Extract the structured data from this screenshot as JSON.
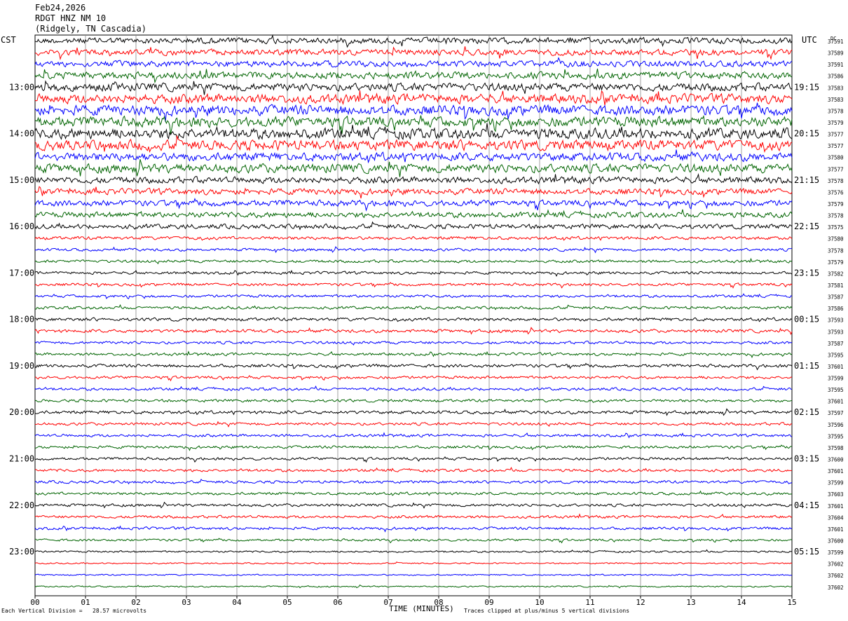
{
  "header": {
    "date": "Feb24,2026",
    "station": "RDGT HNZ NM 10",
    "location": "(Ridgely, TN Cascadia)"
  },
  "tz_left": "CST",
  "tz_right": "UTC",
  "dc_label": "DC",
  "footer": {
    "left": "Each Vertical Division =   28.57 microvolts",
    "center": "TIME (MINUTES)",
    "right": "Traces clipped at plus/minus 5 vertical divisions"
  },
  "chart_data": {
    "type": "line",
    "title": "RDGT HNZ NM 10 (Ridgely, TN Cascadia) Feb24,2026",
    "xlabel": "TIME (MINUTES)",
    "xlim": [
      0,
      15
    ],
    "x_ticks": [
      "00",
      "01",
      "02",
      "03",
      "04",
      "05",
      "06",
      "07",
      "08",
      "09",
      "10",
      "11",
      "12",
      "13",
      "14",
      "15"
    ],
    "trace_minutes": 15,
    "trace_count": 48,
    "trace_colors": [
      "#000000",
      "#ff0000",
      "#0000ff",
      "#006400"
    ],
    "left_time_labels": [
      "",
      "13:00",
      "14:00",
      "15:00",
      "16:00",
      "17:00",
      "18:00",
      "19:00",
      "20:00",
      "21:00",
      "22:00",
      "23:00"
    ],
    "right_time_labels": [
      "",
      "19:15",
      "20:15",
      "21:15",
      "22:15",
      "23:15",
      "00:15",
      "01:15",
      "02:15",
      "03:15",
      "04:15",
      "05:15"
    ],
    "dc_offsets": [
      37591,
      37589,
      37591,
      37586,
      37583,
      37583,
      37578,
      37579,
      37577,
      37577,
      37580,
      37577,
      37578,
      37576,
      37579,
      37578,
      37575,
      37580,
      37578,
      37579,
      37582,
      37581,
      37587,
      37586,
      37593,
      37593,
      37587,
      37595,
      37601,
      37599,
      37595,
      37601,
      37597,
      37596,
      37595,
      37598,
      37600,
      37601,
      37599,
      37603,
      37601,
      37604,
      37601,
      37600,
      37599,
      37602,
      37602,
      37602
    ],
    "noise_amplitude_divisions": [
      1.3,
      1.3,
      1.3,
      1.5,
      1.7,
      2.0,
      2.2,
      2.2,
      2.3,
      2.2,
      1.8,
      1.9,
      1.4,
      1.3,
      1.3,
      1.2,
      1.0,
      0.7,
      0.6,
      0.6,
      0.6,
      0.6,
      0.6,
      0.6,
      0.7,
      0.7,
      0.6,
      0.6,
      0.7,
      0.6,
      0.6,
      0.6,
      0.7,
      0.6,
      0.6,
      0.6,
      0.6,
      0.6,
      0.6,
      0.6,
      0.6,
      0.6,
      0.6,
      0.5,
      0.4,
      0.3,
      0.3,
      0.3
    ],
    "vertical_division_microvolts": 28.57,
    "clip_divisions": 5
  }
}
